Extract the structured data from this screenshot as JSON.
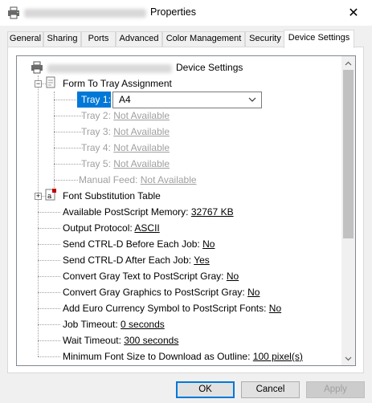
{
  "window": {
    "title_suffix": "Properties",
    "close_label": "✕"
  },
  "tabs": [
    {
      "label": "General"
    },
    {
      "label": "Sharing"
    },
    {
      "label": "Ports"
    },
    {
      "label": "Advanced"
    },
    {
      "label": "Color Management"
    },
    {
      "label": "Security"
    },
    {
      "label": "Device Settings"
    }
  ],
  "tree": {
    "root_label": "Device Settings",
    "form_to_tray": "Form To Tray Assignment",
    "tray1": {
      "label": "Tray 1:",
      "value": "A4"
    },
    "tray2": {
      "label": "Tray 2:",
      "value": "Not Available"
    },
    "tray3": {
      "label": "Tray 3:",
      "value": "Not Available"
    },
    "tray4": {
      "label": "Tray 4:",
      "value": "Not Available"
    },
    "tray5": {
      "label": "Tray 5:",
      "value": "Not Available"
    },
    "manual_feed": {
      "label": "Manual Feed:",
      "value": "Not Available"
    },
    "font_sub": "Font Substitution Table",
    "ps_memory": {
      "label": "Available PostScript Memory:",
      "value": "32767 KB"
    },
    "output_protocol": {
      "label": "Output Protocol:",
      "value": "ASCII"
    },
    "ctrl_d_before": {
      "label": "Send CTRL-D Before Each Job:",
      "value": "No"
    },
    "ctrl_d_after": {
      "label": "Send CTRL-D After Each Job:",
      "value": "Yes"
    },
    "gray_text": {
      "label": "Convert Gray Text to PostScript Gray:",
      "value": "No"
    },
    "gray_graphics": {
      "label": "Convert Gray Graphics to PostScript Gray:",
      "value": "No"
    },
    "euro": {
      "label": "Add Euro Currency Symbol to PostScript Fonts:",
      "value": "No"
    },
    "job_timeout": {
      "label": "Job Timeout:",
      "value": "0 seconds"
    },
    "wait_timeout": {
      "label": "Wait Timeout:",
      "value": "300 seconds"
    },
    "min_font": {
      "label": "Minimum Font Size to Download as Outline:",
      "value": "100 pixel(s)"
    }
  },
  "buttons": {
    "ok": "OK",
    "cancel": "Cancel",
    "apply": "Apply"
  },
  "scrollbar": {
    "position_fraction": 0.0
  }
}
